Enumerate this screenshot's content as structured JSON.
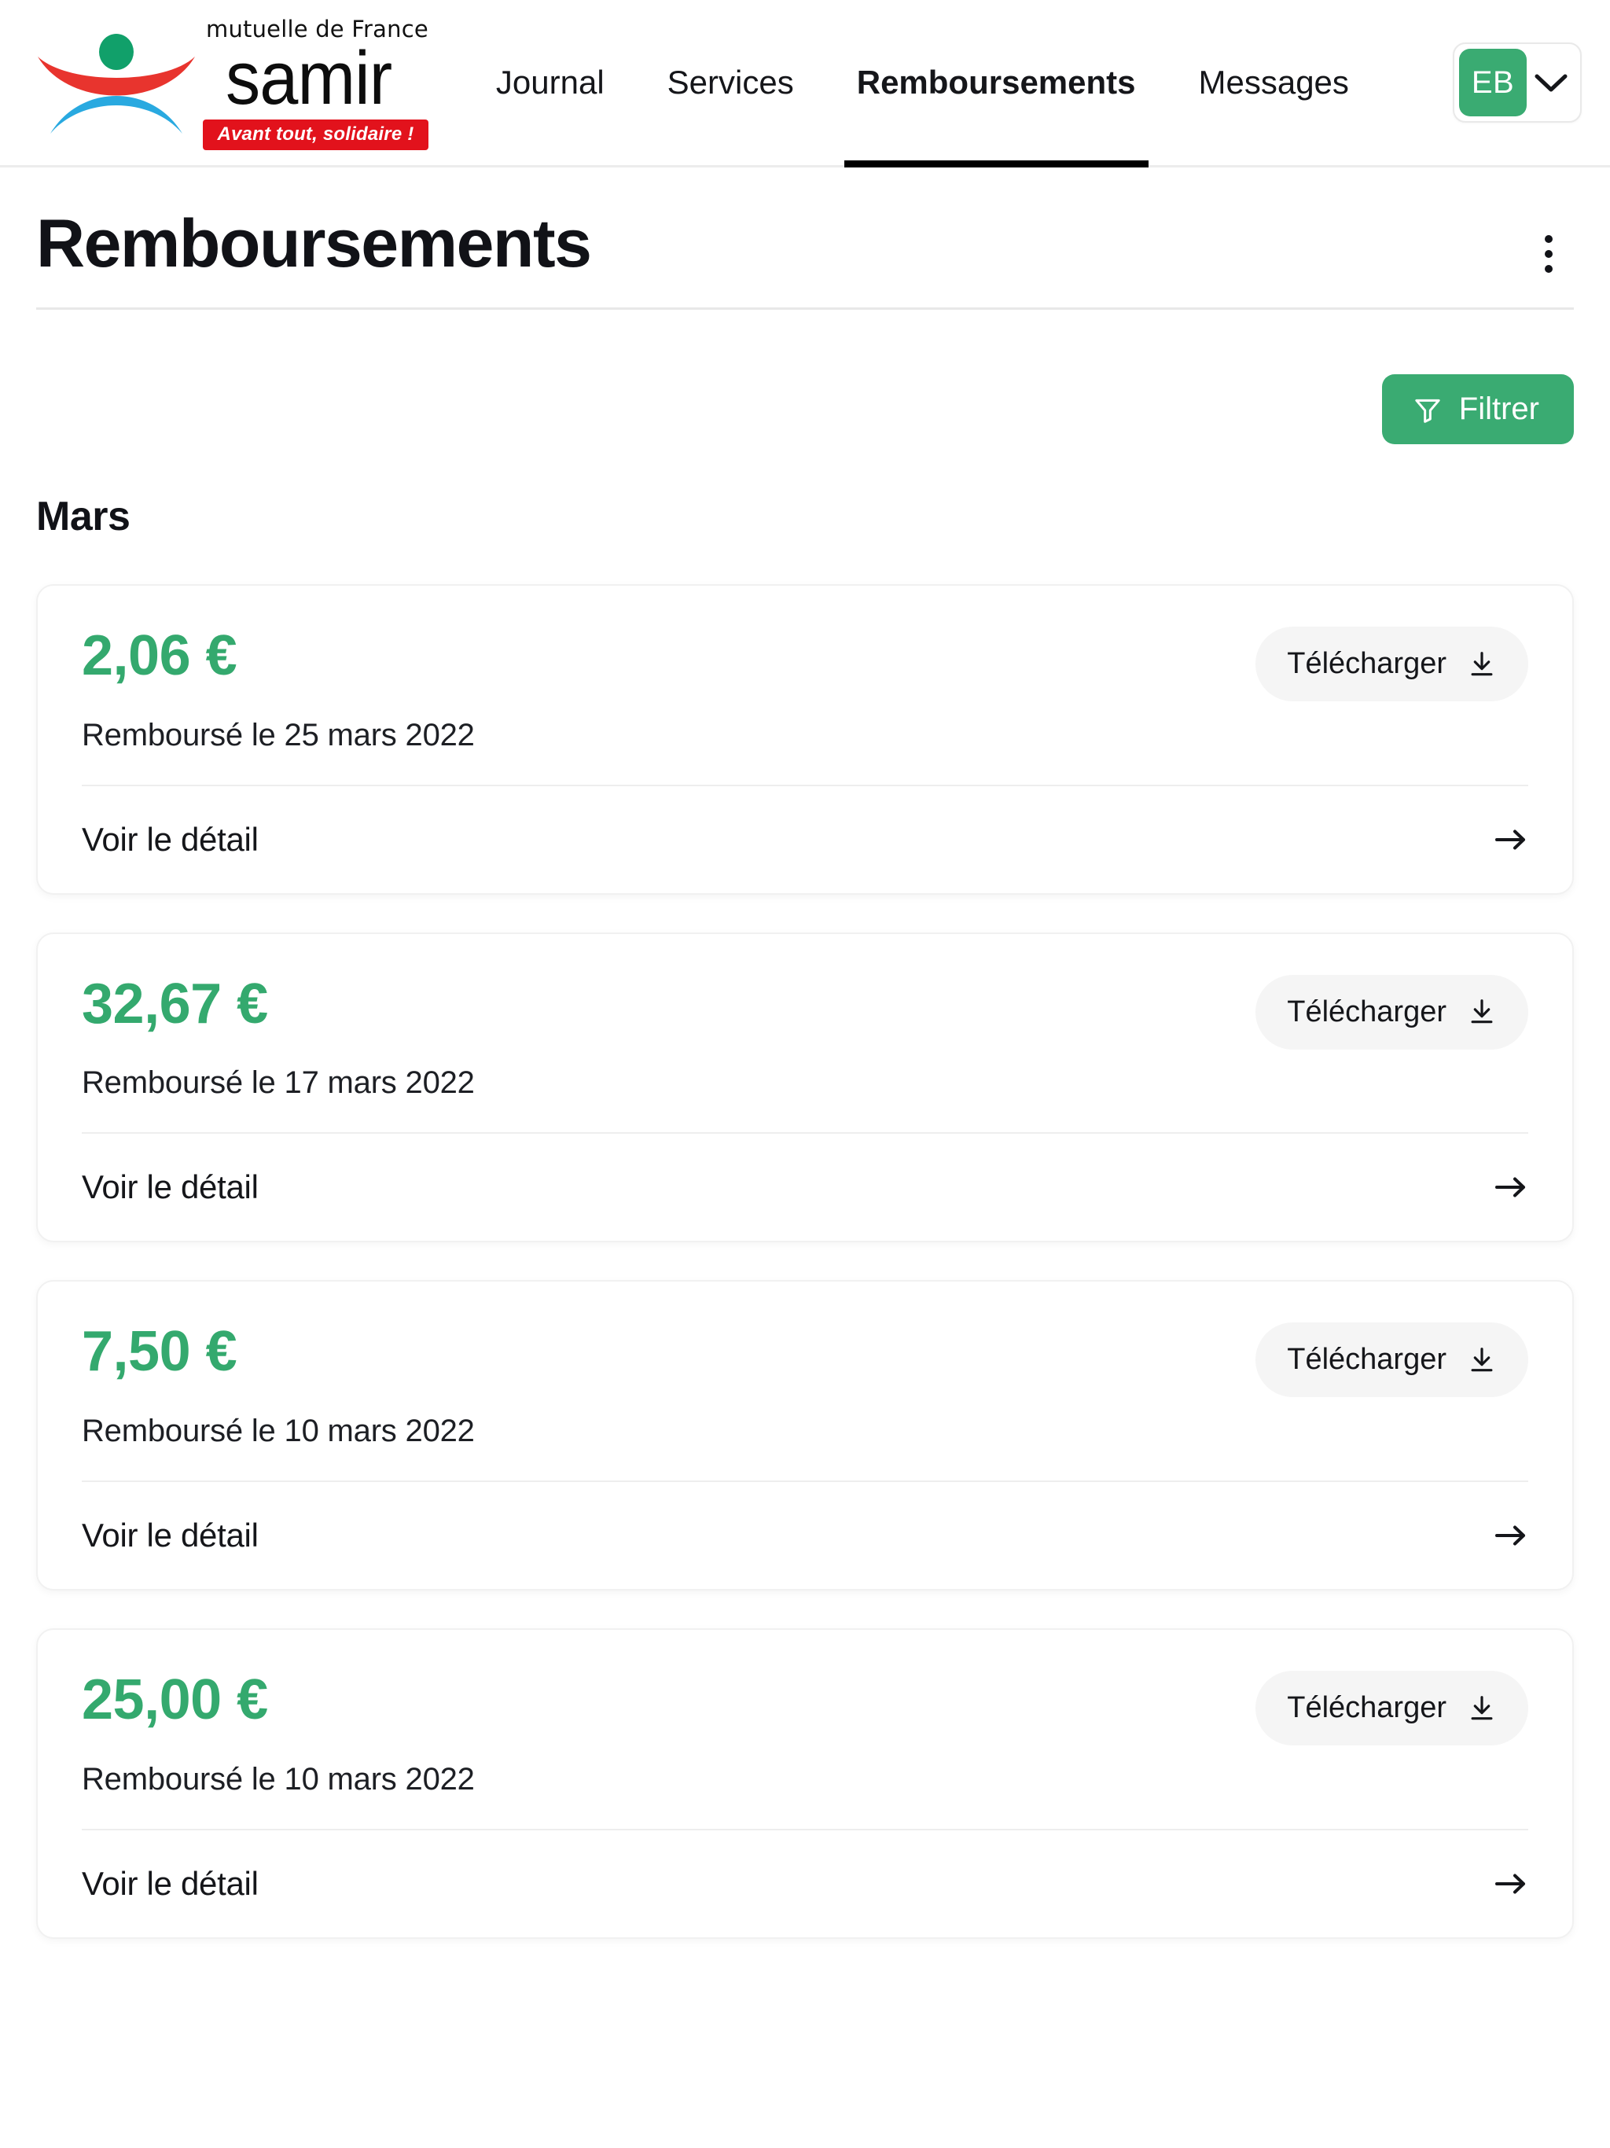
{
  "brand": {
    "tagline_top": "mutuelle de France",
    "name": "samir",
    "slogan": "Avant tout, solidaire !",
    "logo_icon": "samir-swoosh-logo",
    "colors": {
      "red": "#e2121c",
      "blue": "#29a9e0",
      "green": "#11a06a"
    }
  },
  "nav": {
    "items": [
      {
        "label": "Journal",
        "active": false
      },
      {
        "label": "Services",
        "active": false
      },
      {
        "label": "Remboursements",
        "active": true
      },
      {
        "label": "Messages",
        "active": false
      }
    ],
    "account": {
      "initials": "EB",
      "chevron_icon": "chevron-down-icon",
      "avatar_color": "#3aab72"
    }
  },
  "header": {
    "title": "Remboursements",
    "overflow_icon": "kebab-menu-icon"
  },
  "toolbar": {
    "filter_label": "Filtrer",
    "filter_icon": "funnel-icon",
    "filter_color": "#3aab72"
  },
  "groups": [
    {
      "month": "Mars",
      "items": [
        {
          "amount": "2,06 €",
          "date_label": "Remboursé le 25 mars 2022",
          "download_label": "Télécharger",
          "download_icon": "download-icon",
          "detail_label": "Voir le détail",
          "detail_icon": "arrow-right-icon"
        },
        {
          "amount": "32,67 €",
          "date_label": "Remboursé le 17 mars 2022",
          "download_label": "Télécharger",
          "download_icon": "download-icon",
          "detail_label": "Voir le détail",
          "detail_icon": "arrow-right-icon"
        },
        {
          "amount": "7,50 €",
          "date_label": "Remboursé le 10 mars 2022",
          "download_label": "Télécharger",
          "download_icon": "download-icon",
          "detail_label": "Voir le détail",
          "detail_icon": "arrow-right-icon"
        },
        {
          "amount": "25,00 €",
          "date_label": "Remboursé le 10 mars 2022",
          "download_label": "Télécharger",
          "download_icon": "download-icon",
          "detail_label": "Voir le détail",
          "detail_icon": "arrow-right-icon"
        }
      ]
    }
  ],
  "theme": {
    "accent_green": "#3aab72",
    "amount_green": "#34a96e",
    "text_dark": "#15161a"
  }
}
